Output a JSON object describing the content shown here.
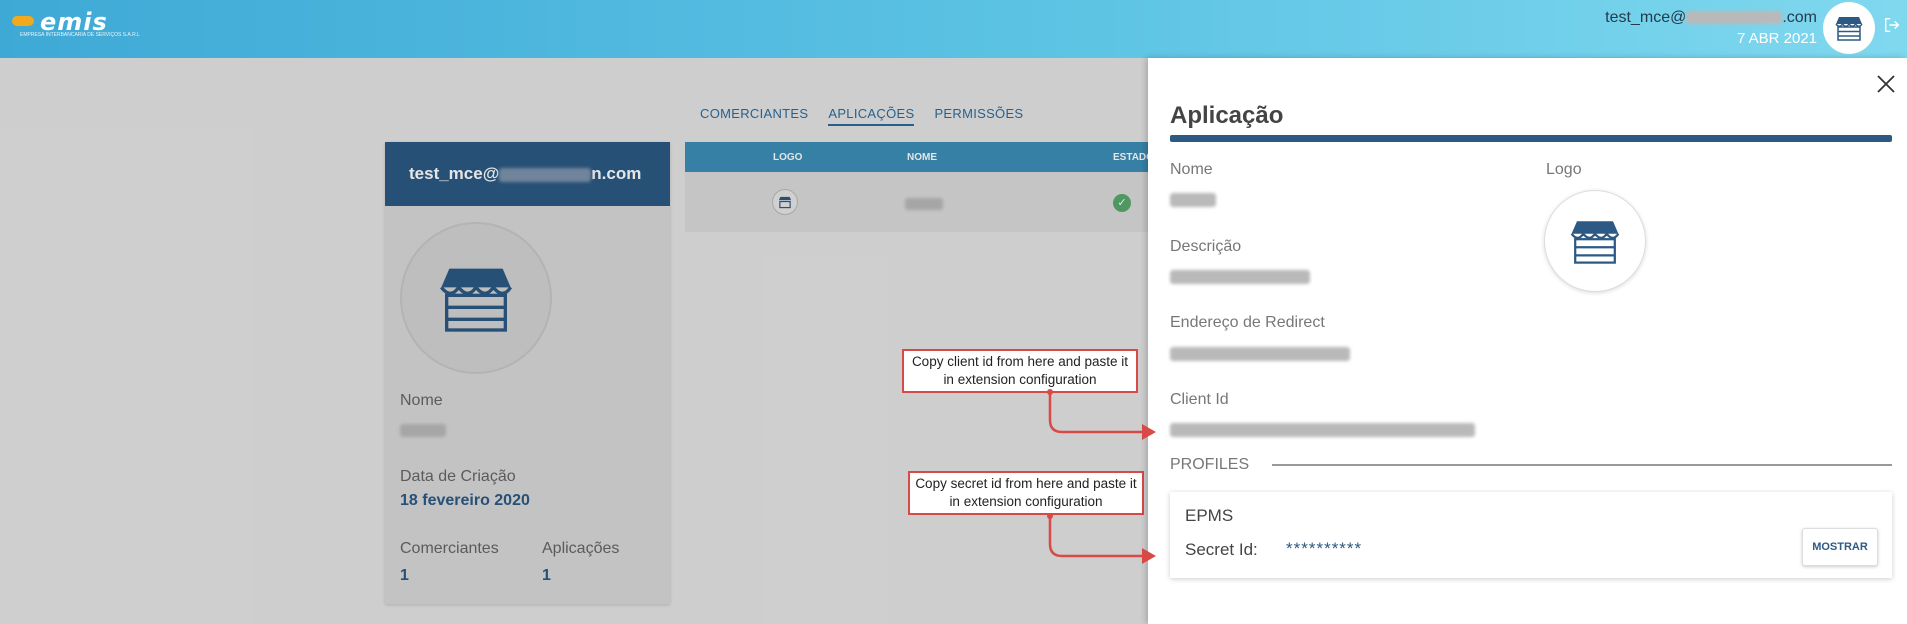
{
  "topbar": {
    "logo_text": "emis",
    "logo_subtext": "EMPRESA INTERBANCARIA DE SERVIÇOS S.A.R.L",
    "user_email_prefix": "test_mce@",
    "user_email_suffix": ".com",
    "date": "7 ABR 2021"
  },
  "tabs": [
    {
      "label": "COMERCIANTES",
      "active": false
    },
    {
      "label": "APLICAÇÕES",
      "active": true
    },
    {
      "label": "PERMISSÕES",
      "active": false
    }
  ],
  "merchant_card": {
    "email_prefix": "test_mce@",
    "email_suffix": "n.com",
    "nome_label": "Nome",
    "data_label": "Data de Criação",
    "data_value": "18 fevereiro 2020",
    "comerciantes_label": "Comerciantes",
    "comerciantes_value": "1",
    "aplicacoes_label": "Aplicações",
    "aplicacoes_value": "1"
  },
  "apps_table": {
    "columns": [
      "LOGO",
      "NOME",
      "ESTADO"
    ]
  },
  "annotations": {
    "client_note": "Copy client id from here and paste it in extension configuration",
    "secret_note": "Copy secret id from here and paste it in extension configuration"
  },
  "panel": {
    "title": "Aplicação",
    "nome_label": "Nome",
    "logo_label": "Logo",
    "descricao_label": "Descrição",
    "redirect_label": "Endereço de Redirect",
    "client_id_label": "Client Id",
    "profiles_label": "PROFILES",
    "profile": {
      "name": "EPMS",
      "secret_label": "Secret Id:",
      "secret_value": "**********",
      "show_button": "MOSTRAR"
    }
  },
  "colors": {
    "brand_dark": "#2c5a85",
    "table_header": "#3e8fb8",
    "annotation": "#d84a45",
    "status_ok": "#5aaa6e"
  },
  "icons": [
    "store-icon",
    "logout-icon",
    "close-icon",
    "check-icon"
  ]
}
